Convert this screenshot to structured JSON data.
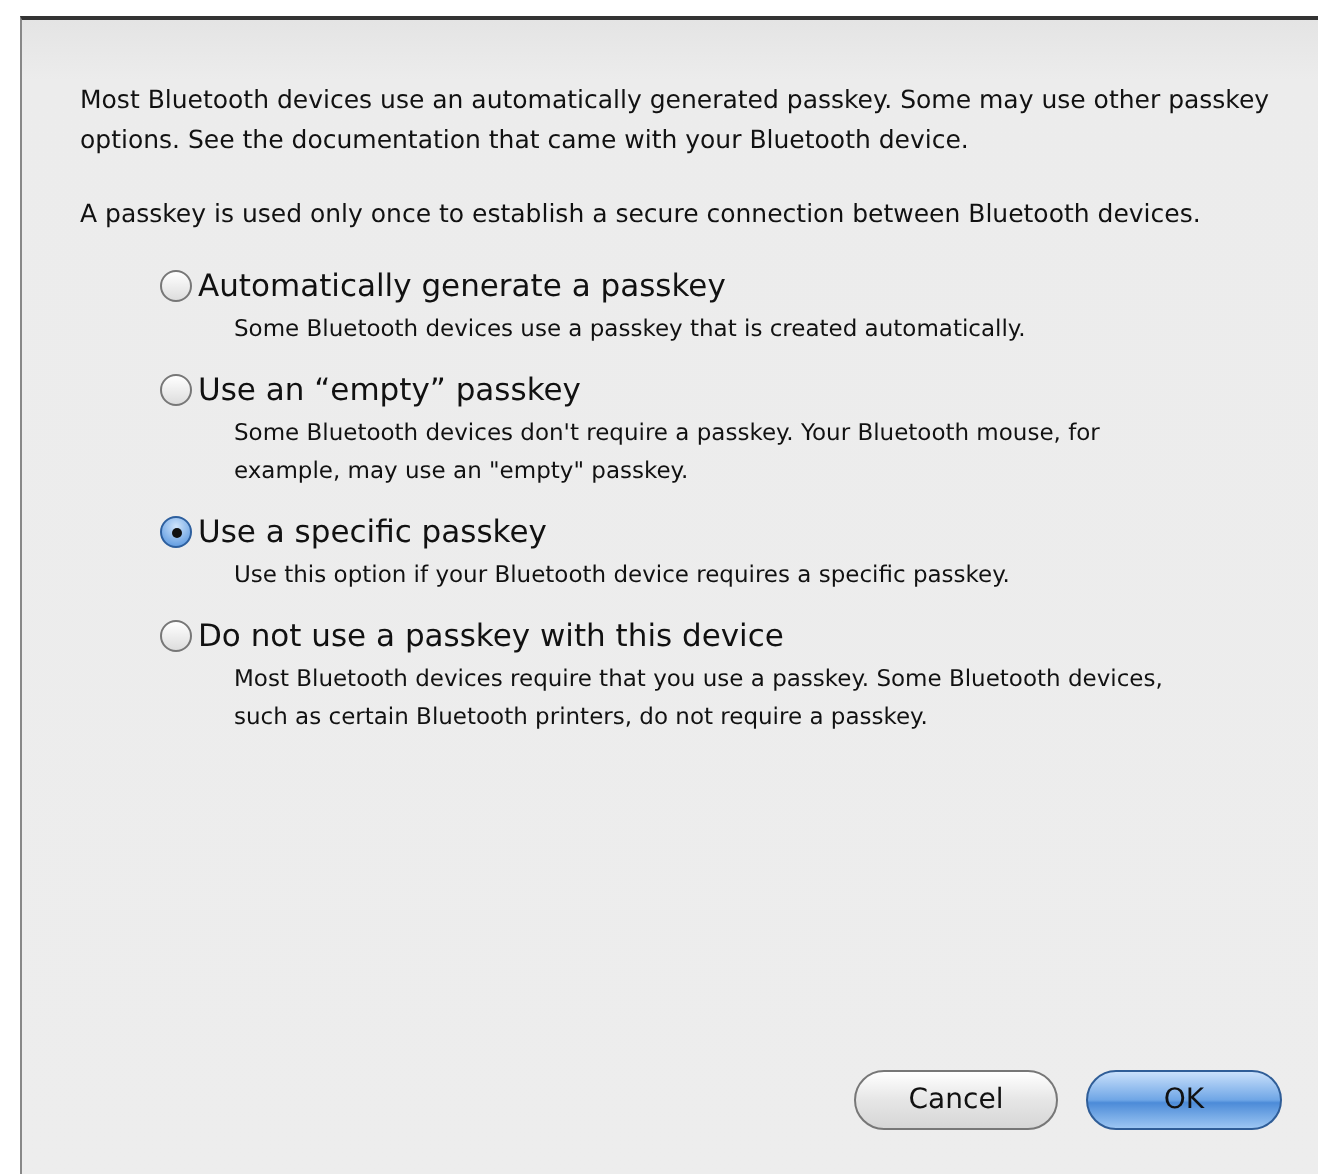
{
  "intro_paragraphs": [
    "Most Bluetooth devices use an automatically generated passkey. Some may use other passkey options. See the documentation that came with your Bluetooth device.",
    "A passkey is used only once to establish a secure connection between Bluetooth devices."
  ],
  "options": [
    {
      "label": "Automatically generate a passkey",
      "description": "Some Bluetooth devices use a passkey that is created automatically.",
      "selected": false
    },
    {
      "label": "Use an “empty” passkey",
      "description": "Some Bluetooth devices don't require a passkey. Your Bluetooth mouse, for example, may use an \"empty\" passkey.",
      "selected": false
    },
    {
      "label": "Use a specific passkey",
      "description": "Use this option if your Bluetooth device requires a specific passkey.",
      "selected": true
    },
    {
      "label": "Do not use a passkey with this device",
      "description": "Most Bluetooth devices require that you use a passkey. Some Bluetooth devices, such as certain Bluetooth printers, do not require a passkey.",
      "selected": false
    }
  ],
  "buttons": [
    {
      "label": "Cancel",
      "kind": "secondary"
    },
    {
      "label": "OK",
      "kind": "default"
    }
  ]
}
